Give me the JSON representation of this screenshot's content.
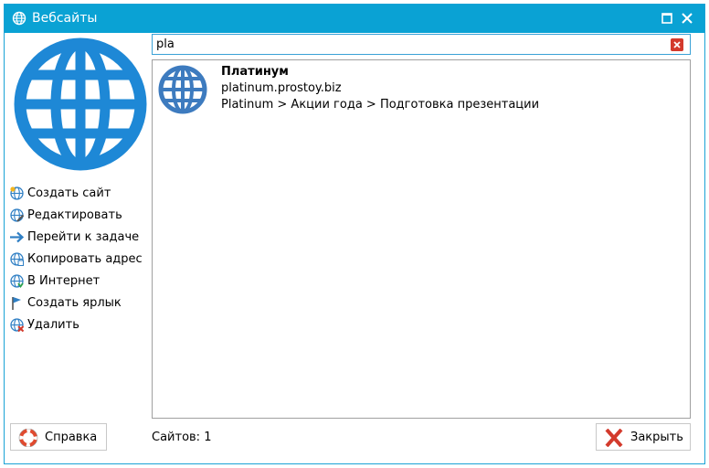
{
  "window": {
    "title": "Вебсайты"
  },
  "titlebar_buttons": {
    "maximize_icon": "maximize-icon",
    "close_icon": "close-icon"
  },
  "actions": [
    {
      "label": "Создать сайт",
      "icon": "globe-new-icon"
    },
    {
      "label": "Редактировать",
      "icon": "globe-edit-icon"
    },
    {
      "label": "Перейти к задаче",
      "icon": "arrow-right-icon"
    },
    {
      "label": "Копировать адрес",
      "icon": "globe-copy-icon"
    },
    {
      "label": "В Интернет",
      "icon": "globe-download-icon"
    },
    {
      "label": "Создать ярлык",
      "icon": "flag-icon"
    },
    {
      "label": "Удалить",
      "icon": "globe-delete-icon"
    }
  ],
  "search": {
    "value": "pla"
  },
  "results": [
    {
      "name": "Платинум",
      "url": "platinum.prostoy.biz",
      "path": "Platinum > Акции года > Подготовка презентации"
    }
  ],
  "footer": {
    "help_label": "Справка",
    "status": "Сайтов: 1",
    "close_label": "Закрыть"
  },
  "colors": {
    "accent": "#0aa2d4",
    "globe": "#1e88d6",
    "delete": "#d33a2c"
  }
}
